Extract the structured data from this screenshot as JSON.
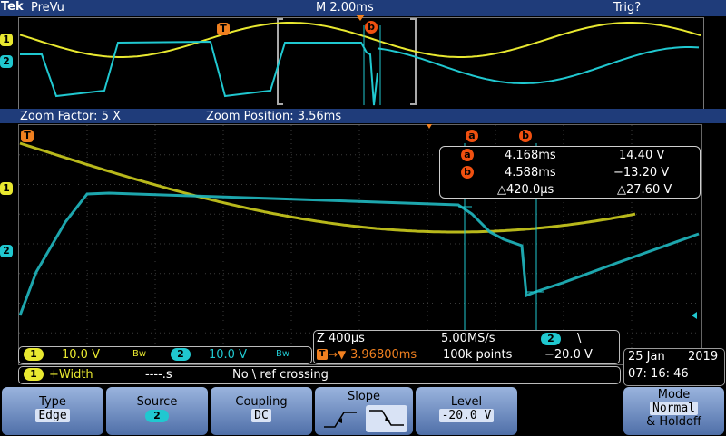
{
  "header": {
    "brand": "Tek",
    "mode": "PreVu",
    "timebase": "M 2.00ms",
    "trigger_status": "Trig?"
  },
  "zoom": {
    "factor_text": "Zoom Factor: 5 X",
    "position_text": "Zoom Position: 3.56ms"
  },
  "markers": {
    "trigger": "T",
    "cursor_a": "a",
    "cursor_b": "b",
    "ch1": "1",
    "ch2": "2"
  },
  "cursor_readout": {
    "a_time": "4.168ms",
    "a_value": "14.40 V",
    "b_time": "4.588ms",
    "b_value": "−13.20 V",
    "delta_time": "△420.0µs",
    "delta_value": "△27.60 V"
  },
  "channels": {
    "ch1_scale": "10.0 V",
    "ch2_scale": "10.0 V",
    "bw_symbol": "Bᴡ"
  },
  "acquisition": {
    "zoom_time": "Z 400µs",
    "sample_rate": "5.00MS/s",
    "trigger_position": "3.96800ms",
    "record_length": "100k points",
    "trigger_channel": "2",
    "trigger_slope_symbol": "\\",
    "trigger_level": "−20.0 V"
  },
  "measurement": {
    "channel": "1",
    "name": "+Width",
    "value": "----.s",
    "status": "No \\ ref crossing"
  },
  "datetime": {
    "date": "25 Jan",
    "year": "2019",
    "time": "07: 16: 46"
  },
  "menu": {
    "type_label": "Type",
    "type_value": "Edge",
    "source_label": "Source",
    "source_value": "2",
    "coupling_label": "Coupling",
    "coupling_value": "DC",
    "slope_label": "Slope",
    "level_label": "Level",
    "level_value": "-20.0 V",
    "mode_label": "Mode",
    "mode_value": "Normal",
    "mode_value2": "& Holdoff"
  },
  "colors": {
    "ch1": "#e8e830",
    "ch2": "#20c8d0",
    "trigger": "#f08020",
    "grid": "#3a3a3a",
    "button_bg": "#7f9bcc"
  }
}
